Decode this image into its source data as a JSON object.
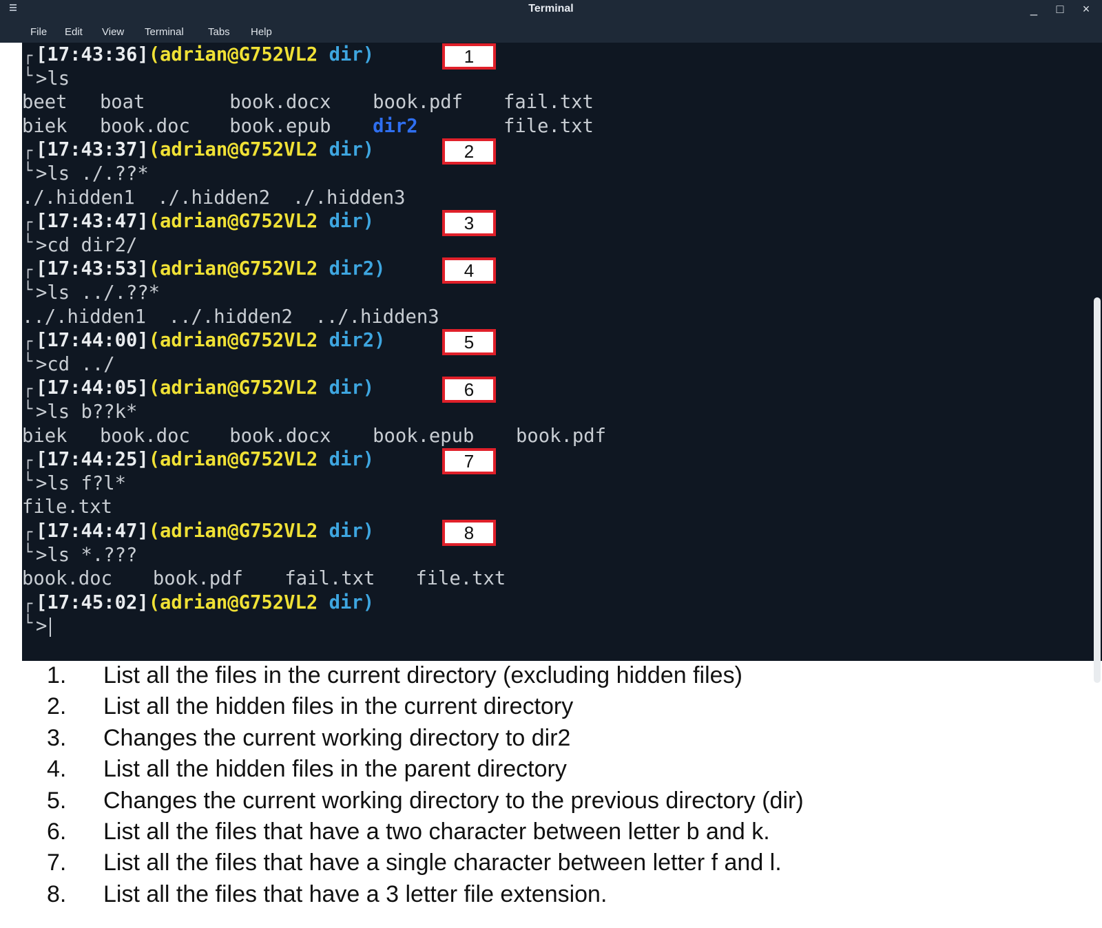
{
  "window": {
    "title": "Terminal",
    "minimize": "_",
    "maximize": "□",
    "close": "×"
  },
  "menu": [
    "File",
    "Edit",
    "View",
    "Terminal",
    "Tabs",
    "Help"
  ],
  "prompts": [
    {
      "time": "[17:43:36]",
      "user": "(adrian@G752VL2",
      "dir": "dir)",
      "cmd": ">ls",
      "label": "1"
    },
    {
      "time": "[17:43:37]",
      "user": "(adrian@G752VL2",
      "dir": "dir)",
      "cmd": ">ls ./.??*",
      "label": "2"
    },
    {
      "time": "[17:43:47]",
      "user": "(adrian@G752VL2",
      "dir": "dir)",
      "cmd": ">cd dir2/",
      "label": "3"
    },
    {
      "time": "[17:43:53]",
      "user": "(adrian@G752VL2",
      "dir": "dir2)",
      "cmd": ">ls ../.??*",
      "label": "4"
    },
    {
      "time": "[17:44:00]",
      "user": "(adrian@G752VL2",
      "dir": "dir2)",
      "cmd": ">cd ../",
      "label": "5"
    },
    {
      "time": "[17:44:05]",
      "user": "(adrian@G752VL2",
      "dir": "dir)",
      "cmd": ">ls b??k*",
      "label": "6"
    },
    {
      "time": "[17:44:25]",
      "user": "(adrian@G752VL2",
      "dir": "dir)",
      "cmd": ">ls f?l*",
      "label": "7"
    },
    {
      "time": "[17:44:47]",
      "user": "(adrian@G752VL2",
      "dir": "dir)",
      "cmd": ">ls *.???",
      "label": "8"
    },
    {
      "time": "[17:45:02]",
      "user": "(adrian@G752VL2",
      "dir": "dir)",
      "cmd": ">",
      "label": ""
    }
  ],
  "outputs": {
    "ls_row1": [
      "beet",
      "boat",
      "book.docx",
      "book.pdf",
      "fail.txt"
    ],
    "ls_row2": [
      "biek",
      "book.doc",
      "book.epub",
      "dir2",
      "file.txt"
    ],
    "hidden_cur": "./.hidden1  ./.hidden2  ./.hidden3",
    "hidden_parent": "../.hidden1  ../.hidden2  ../.hidden3",
    "b_k": [
      "biek",
      "book.doc",
      "book.docx",
      "book.epub",
      "book.pdf"
    ],
    "f_l": "file.txt",
    "ext3": [
      "book.doc",
      "book.pdf",
      "fail.txt",
      "file.txt"
    ]
  },
  "colors": {
    "terminal_bg": "#0f1722",
    "username": "#f0e135",
    "directory": "#3ea6e0",
    "dir_listing": "#2f6ff0",
    "label_border": "#e0202a"
  },
  "explanations": [
    {
      "num": "1.",
      "text": "List all the files in the current directory (excluding hidden files)"
    },
    {
      "num": "2.",
      "text": "List all the hidden files in the current directory"
    },
    {
      "num": "3.",
      "text": "Changes the current working directory to dir2"
    },
    {
      "num": "4.",
      "text": "List all the hidden files in the parent directory"
    },
    {
      "num": "5.",
      "text": "Changes the current working directory to the previous directory (dir)"
    },
    {
      "num": "6.",
      "text": "List all the files that have a two character between letter b and k."
    },
    {
      "num": "7.",
      "text": "List all the files that have a single character between letter f and l."
    },
    {
      "num": "8.",
      "text": "List all the files that have a 3 letter file extension."
    }
  ]
}
